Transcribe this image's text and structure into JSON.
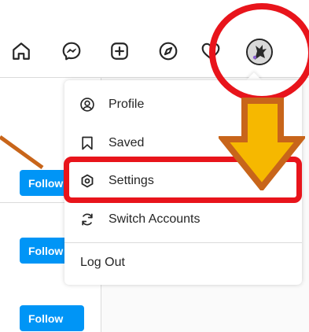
{
  "menu": {
    "items": [
      {
        "label": "Profile",
        "icon": "user-circle-icon"
      },
      {
        "label": "Saved",
        "icon": "bookmark-icon"
      },
      {
        "label": "Settings",
        "icon": "gear-icon"
      },
      {
        "label": "Switch Accounts",
        "icon": "switch-arrows-icon"
      }
    ],
    "logout_label": "Log Out"
  },
  "suggestions": {
    "follow_label": "Follow",
    "buttons": [
      "Follow",
      "Follow",
      "Follow"
    ]
  },
  "nav": {
    "icons": [
      "home-icon",
      "messenger-icon",
      "new-post-icon",
      "explore-compass-icon",
      "heart-icon",
      "profile-avatar"
    ]
  },
  "annotations": {
    "highlight_color": "#e8141b",
    "arrow_fill": "#f6b800",
    "arrow_outline": "#c8651a",
    "pointer_color": "#c8651a"
  },
  "colors": {
    "follow_button": "#0095f6",
    "text": "#262626",
    "border": "#dbdbdb"
  }
}
